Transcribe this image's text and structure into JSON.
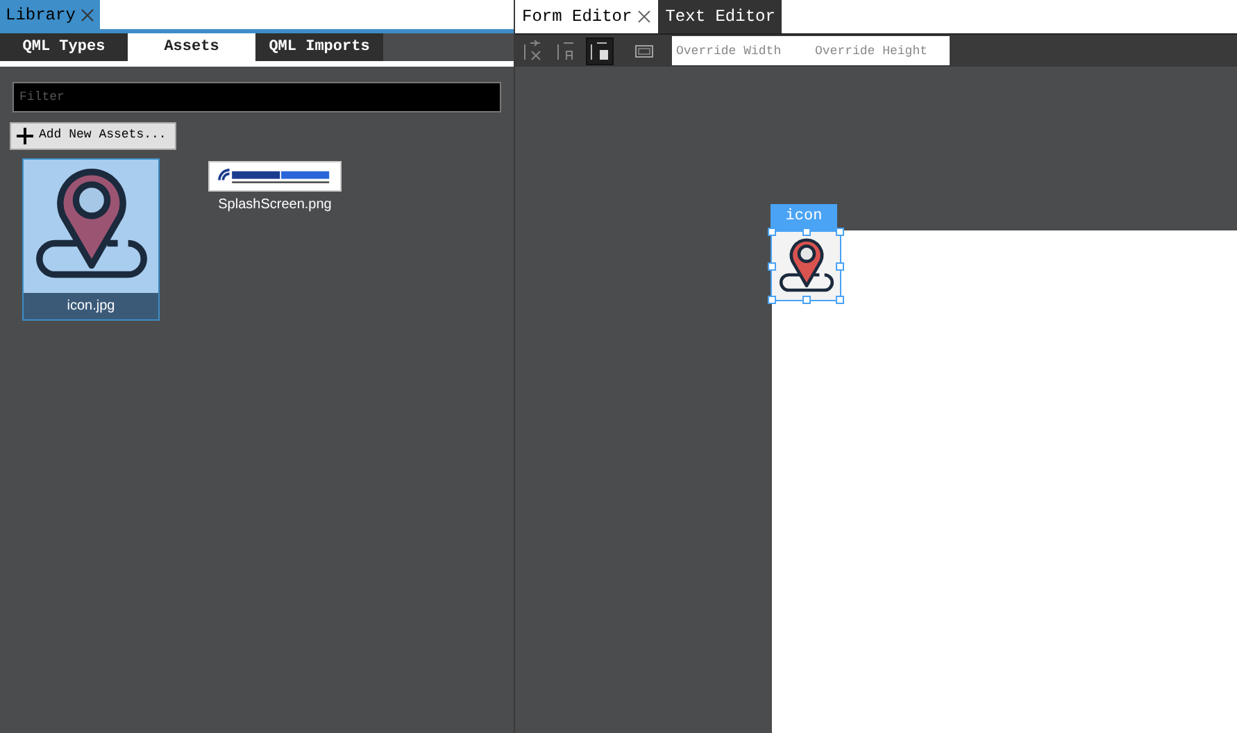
{
  "library_panel": {
    "tabs": [
      {
        "label": "Library",
        "selected": true
      }
    ],
    "subtabs": [
      {
        "label": "QML Types",
        "selected": false
      },
      {
        "label": "Assets",
        "selected": true
      },
      {
        "label": "QML Imports",
        "selected": false
      }
    ],
    "filter": {
      "placeholder": "Filter"
    },
    "add_button": {
      "label": "Add New Assets..."
    },
    "assets": [
      {
        "name": "icon.jpg",
        "selected": true,
        "kind": "pin"
      },
      {
        "name": "SplashScreen.png",
        "selected": false,
        "kind": "logo"
      }
    ]
  },
  "editor": {
    "tabs": [
      {
        "label": "Form Editor",
        "selected": true
      },
      {
        "label": "Text Editor",
        "selected": false
      }
    ],
    "toolbar": [
      {
        "kind": "snap-off",
        "selected": false
      },
      {
        "kind": "snap-anchors",
        "selected": false
      },
      {
        "kind": "snap-margins",
        "selected": true
      },
      {
        "kind": "bounds",
        "selected": false
      }
    ],
    "override_width": {
      "placeholder": "Override Width"
    },
    "override_height": {
      "placeholder": "Override Height"
    },
    "canvas": {
      "item_label": "icon",
      "selected": true
    }
  }
}
